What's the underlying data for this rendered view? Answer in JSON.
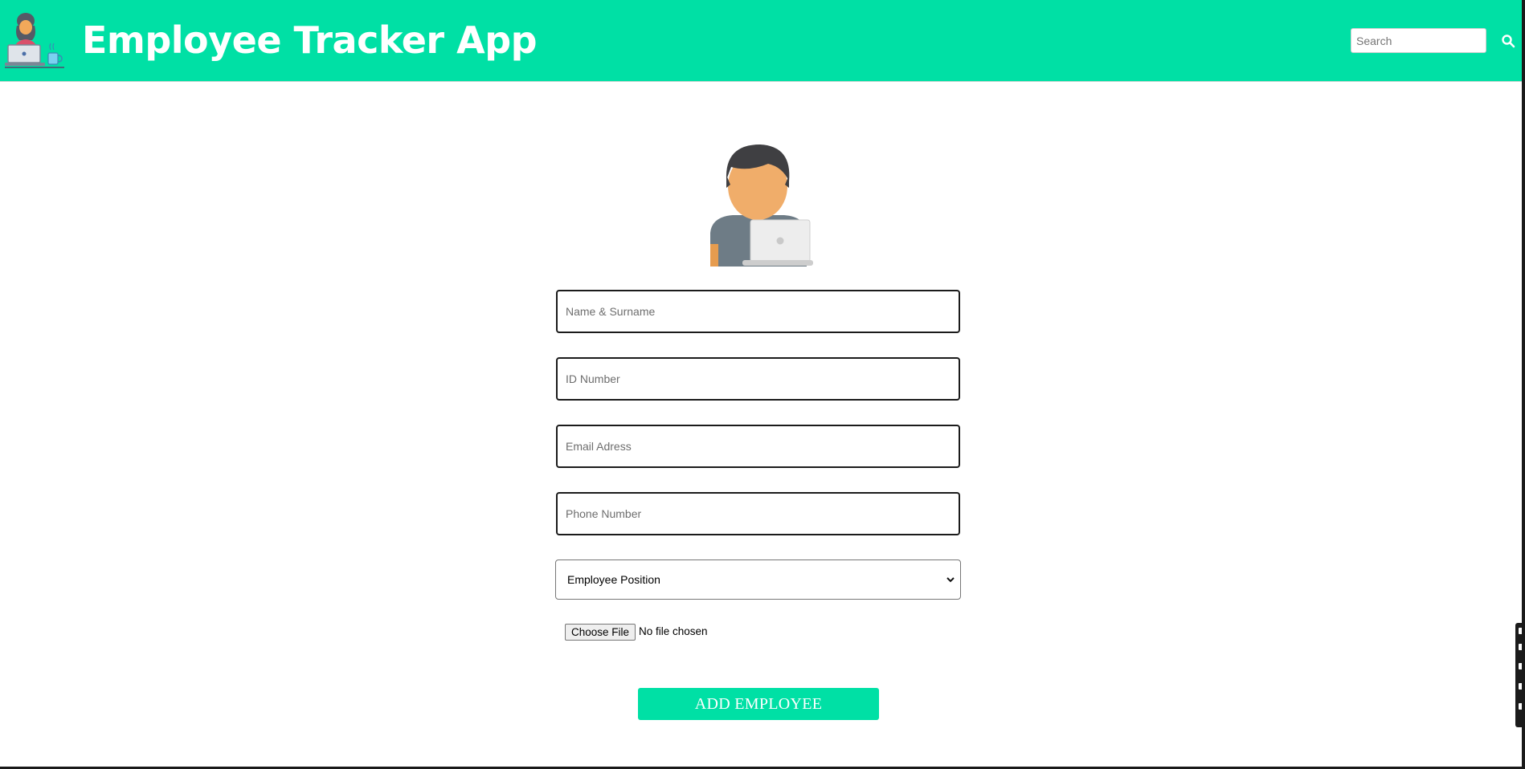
{
  "header": {
    "title": "Employee Tracker App",
    "logo_icon": "employee-at-laptop-icon",
    "search": {
      "placeholder": "Search",
      "value": ""
    },
    "search_icon": "search-icon"
  },
  "form": {
    "avatar_icon": "employee-avatar-icon",
    "fields": [
      {
        "placeholder": "Name & Surname",
        "value": ""
      },
      {
        "placeholder": "ID Number",
        "value": ""
      },
      {
        "placeholder": "Email Adress",
        "value": ""
      },
      {
        "placeholder": "Phone Number",
        "value": ""
      }
    ],
    "position_select": {
      "selected": "Employee Position"
    },
    "file_input": {
      "button_label": "Choose File",
      "status": "No file chosen"
    },
    "submit_label": "ADD EMPLOYEE"
  },
  "colors": {
    "brand": "#00e0a5",
    "text_on_brand": "#ffffff"
  }
}
